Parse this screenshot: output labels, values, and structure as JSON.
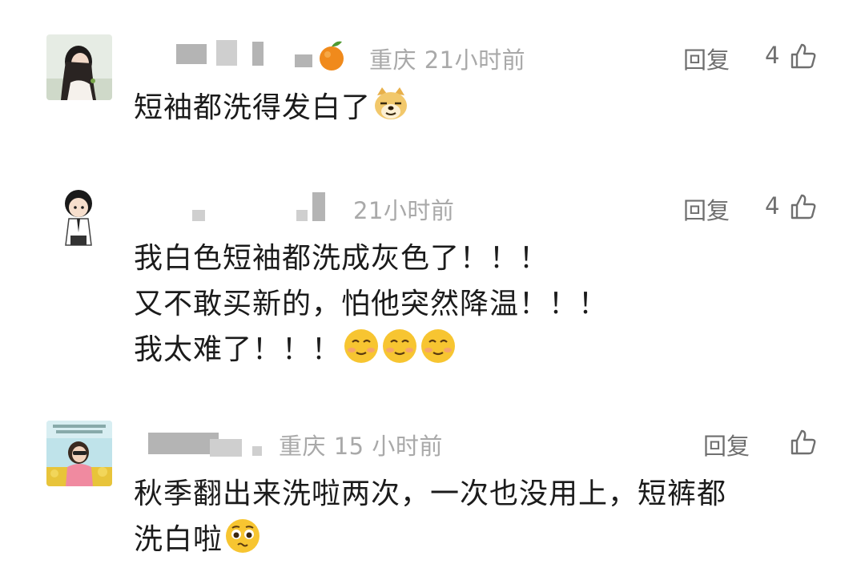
{
  "comments": [
    {
      "location": "重庆",
      "time": "21小时前",
      "reply_label": "回复",
      "likes": "4",
      "lines": [
        "短袖都洗得发白了"
      ],
      "emoji_icons": [
        "doge-emoji-icon"
      ]
    },
    {
      "location": "",
      "time": "21小时前",
      "reply_label": "回复",
      "likes": "4",
      "lines": [
        "我白色短袖都洗成灰色了！！！",
        "又不敢买新的，怕他突然降温！！！",
        "我太难了！！！"
      ],
      "emoji_icons": [
        "smiling-tears-emoji-icon",
        "smiling-tears-emoji-icon",
        "smiling-tears-emoji-icon"
      ]
    },
    {
      "location": "重庆",
      "time": "15 小时前",
      "reply_label": "回复",
      "likes": "",
      "lines": [
        "秋季翻出来洗啦两次，一次也没用上，短裤都",
        "洗白啦"
      ],
      "emoji_icons": [
        "pleading-emoji-icon"
      ]
    }
  ],
  "icons": {
    "badge": "orange-fruit-icon",
    "like": "thumbs-up-icon"
  },
  "colors": {
    "meta_text": "#a9a9a9",
    "body_text": "#1b1b1b",
    "action_text": "#6f6f6f",
    "emoji_yellow": "#f7c531"
  }
}
